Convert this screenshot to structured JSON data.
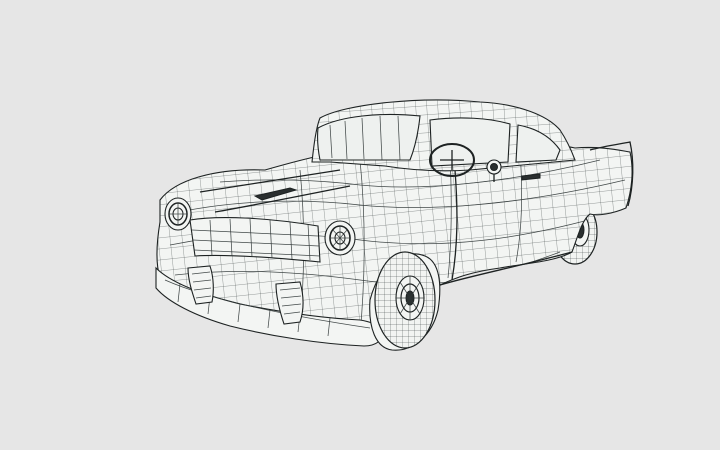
{
  "scene": {
    "subject": "car-wireframe-model",
    "background_color": "#e6e6e6",
    "mesh_color": "#2f3636",
    "surface_color": "#f3f5f3"
  }
}
